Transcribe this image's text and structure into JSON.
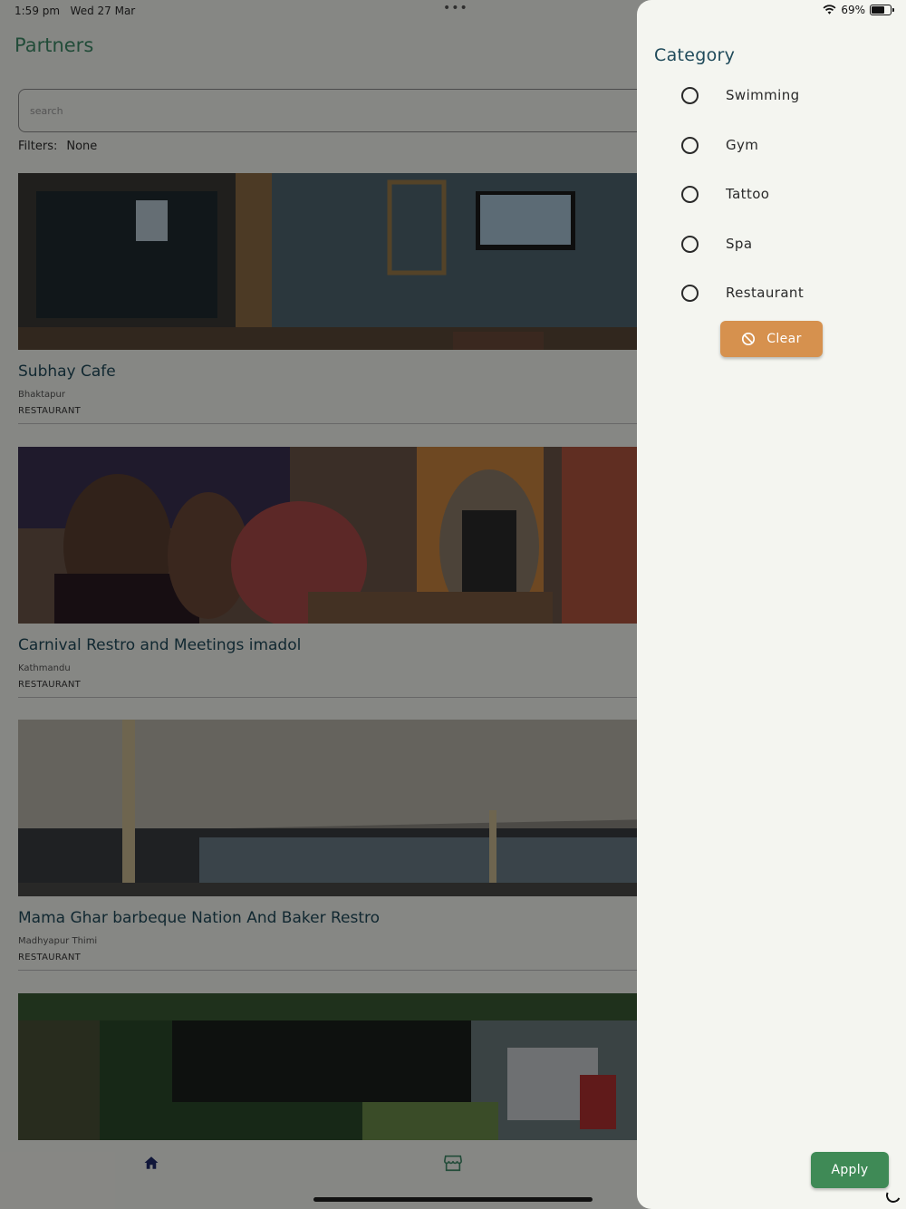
{
  "status_bar": {
    "time": "1:59 pm",
    "date": "Wed 27 Mar",
    "battery": "69%",
    "battery_level": 0.69,
    "dots": "•••"
  },
  "header": {
    "title": "Partners"
  },
  "search": {
    "placeholder": "search",
    "value": ""
  },
  "filters": {
    "label": "Filters:",
    "value": "None"
  },
  "partners": [
    {
      "name": "Subhay Cafe",
      "location": "Bhaktapur",
      "category": "RESTAURANT"
    },
    {
      "name": "Carnival Restro and Meetings imadol",
      "location": "Kathmandu",
      "category": "RESTAURANT"
    },
    {
      "name": "Mama Ghar  barbeque Nation And Baker Restro",
      "location": "Madhyapur Thimi",
      "category": "RESTAURANT"
    },
    {
      "name": "",
      "location": "",
      "category": ""
    }
  ],
  "bottom_nav": {
    "items": [
      {
        "icon": "home-icon"
      },
      {
        "icon": "store-icon"
      }
    ]
  },
  "drawer": {
    "title": "Category",
    "options": [
      {
        "label": "Swimming",
        "selected": false
      },
      {
        "label": "Gym",
        "selected": false
      },
      {
        "label": "Tattoo",
        "selected": false
      },
      {
        "label": "Spa",
        "selected": false
      },
      {
        "label": "Restaurant",
        "selected": false
      }
    ],
    "clear_label": "Clear",
    "apply_label": "Apply"
  },
  "colors": {
    "title_green": "#3f8a68",
    "card_title": "#1f4a5a",
    "clear_orange": "#d6914e",
    "apply_green": "#3f8a56"
  }
}
